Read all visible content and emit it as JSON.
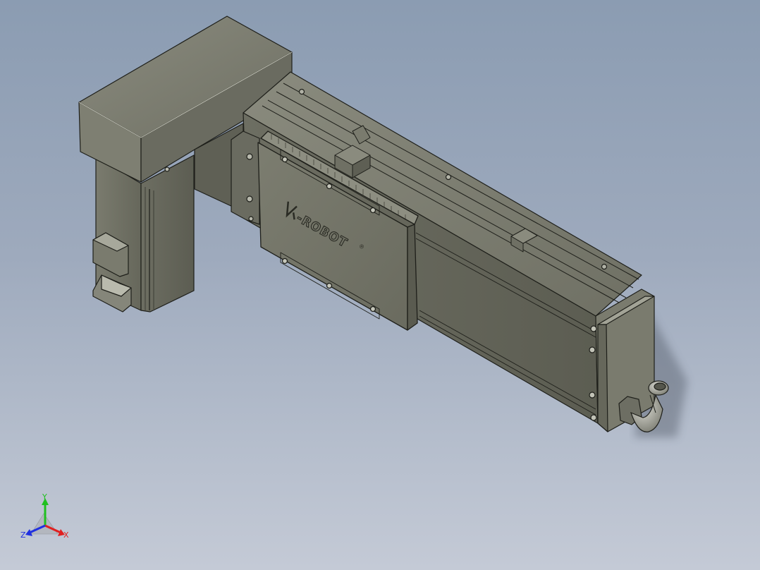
{
  "viewport": {
    "background_top": "#8b9cb2",
    "background_bottom": "#c4cad6"
  },
  "model": {
    "logo_text": "-ROBOT",
    "logo_mark": "®",
    "body_color": "#76776a",
    "edge_color": "#1e1f1a"
  },
  "triad": {
    "x_label": "X",
    "y_label": "Y",
    "z_label": "Z",
    "x_color": "#e02020",
    "y_color": "#20c020",
    "z_color": "#2030e0"
  }
}
